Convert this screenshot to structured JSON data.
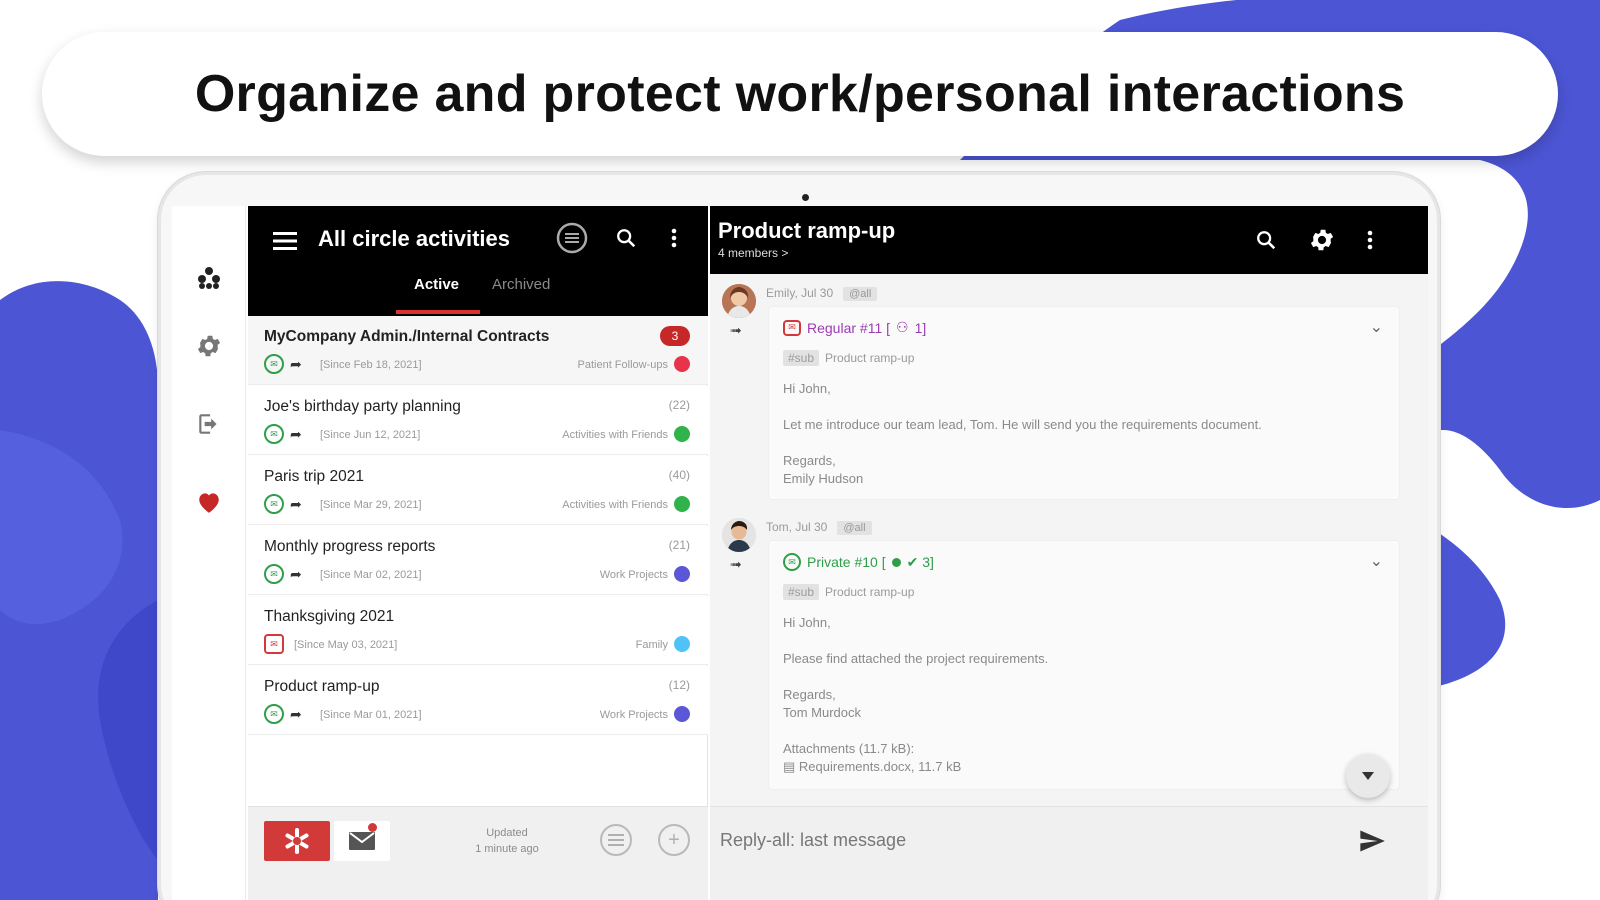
{
  "headline": "Organize and protect work/personal interactions",
  "colors": {
    "brand_blue": "#4c55d4",
    "accent_red": "#d23a3a",
    "green": "#2e9e48"
  },
  "rail": {
    "icons": [
      "circles-icon",
      "gear-icon",
      "logout-icon",
      "heart-icon"
    ]
  },
  "left_pane": {
    "title": "All circle activities",
    "tabs": [
      {
        "label": "Active",
        "selected": true
      },
      {
        "label": "Archived",
        "selected": false
      }
    ],
    "items": [
      {
        "title": "MyCompany Admin./Internal Contracts",
        "badge": "3",
        "since": "[Since Feb 18, 2021]",
        "category": "Patient Follow-ups",
        "dot": "#e8334a"
      },
      {
        "title": "Joe's birthday party planning",
        "count": "(22)",
        "since": "[Since Jun 12, 2021]",
        "category": "Activities with Friends",
        "dot": "#2fb34a"
      },
      {
        "title": "Paris trip 2021",
        "count": "(40)",
        "since": "[Since Mar 29, 2021]",
        "category": "Activities with Friends",
        "dot": "#2fb34a"
      },
      {
        "title": "Monthly progress reports",
        "count": "(21)",
        "since": "[Since Mar 02, 2021]",
        "category": "Work Projects",
        "dot": "#5b57d6"
      },
      {
        "title": "Thanksgiving 2021",
        "count": "",
        "since": "[Since May 03, 2021]",
        "category": "Family",
        "dot": "#4fc3f7"
      },
      {
        "title": "Product ramp-up",
        "count": "(12)",
        "since": "[Since Mar 01, 2021]",
        "category": "Work Projects",
        "dot": "#5b57d6"
      }
    ],
    "updated_line1": "Updated",
    "updated_line2": "1 minute ago"
  },
  "chat": {
    "title": "Product ramp-up",
    "subtitle": "4 members >",
    "messages": [
      {
        "meta": "Emily, Jul 30",
        "chip": "@all",
        "head": "Regular #11 [ ",
        "head_tail": " 1]",
        "sub_tag": "#sub",
        "sub_text": "Product ramp-up",
        "greeting": "Hi John,",
        "body": "Let me introduce our team lead, Tom. He will send you the requirements document.",
        "sign1": "Regards,",
        "sign2": "Emily Hudson"
      },
      {
        "meta": "Tom, Jul 30",
        "chip": "@all",
        "head": "Private #10 [ ",
        "head_tail": " ✔ 3]",
        "sub_tag": "#sub",
        "sub_text": "Product ramp-up",
        "greeting": "Hi John,",
        "body": "Please find attached the project requirements.",
        "sign1": "Regards,",
        "sign2": "Tom Murdock",
        "attachments": "Attachments (11.7 kB):",
        "file": "Requirements.docx, 11.7 kB"
      }
    ],
    "reply_placeholder": "Reply-all: last message"
  }
}
